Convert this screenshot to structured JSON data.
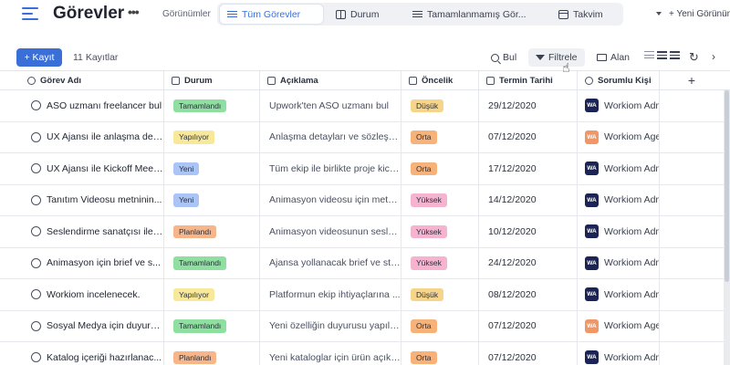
{
  "header": {
    "title": "Görevler",
    "more": "•••",
    "views_label": "Görünümler",
    "tabs": [
      {
        "label": "Tüm Görevler",
        "icon": "list-icon"
      },
      {
        "label": "Durum",
        "icon": "board-icon"
      },
      {
        "label": "Tamamlanmamış Gör...",
        "icon": "list-icon"
      },
      {
        "label": "Takvim",
        "icon": "calendar-icon"
      }
    ],
    "new_view": "+ Yeni Görünüm"
  },
  "toolbar": {
    "add_label": "+ Kayıt",
    "record_count": "11 Kayıtlar",
    "search_label": "Bul",
    "filter_label": "Filtrele",
    "field_label": "Alan",
    "refresh_glyph": "↻",
    "chevron_glyph": "›"
  },
  "table": {
    "columns": [
      "Görev Adı",
      "Durum",
      "Açıklama",
      "Öncelik",
      "Termin Tarihi",
      "Sorumlu Kişi"
    ],
    "add_column": "+",
    "rows": [
      {
        "title": "ASO uzmanı freelancer bul",
        "status": "Tamamlandı",
        "status_color": "#8fe0a0",
        "desc": "Upwork'ten ASO uzmanı bul",
        "priority": "Düşük",
        "priority_color": "#f6d48a",
        "date": "29/12/2020",
        "owner_initials": "WA",
        "owner_color": "#1c2456",
        "owner": "Workiom Adm"
      },
      {
        "title": "UX Ajansı ile anlaşma det...",
        "status": "Yapılıyor",
        "status_color": "#f7e89a",
        "desc": "Anlaşma detayları ve sözleşm...",
        "priority": "Orta",
        "priority_color": "#f7b27a",
        "date": "07/12/2020",
        "owner_initials": "WA",
        "owner_color": "#f19665",
        "owner": "Workiom Agen"
      },
      {
        "title": "UX Ajansı ile Kickoff Meet...",
        "status": "Yeni",
        "status_color": "#a9c4f5",
        "desc": "Tüm ekip ile birlikte proje kick...",
        "priority": "Orta",
        "priority_color": "#f7b27a",
        "date": "17/12/2020",
        "owner_initials": "WA",
        "owner_color": "#1c2456",
        "owner": "Workiom Adm"
      },
      {
        "title": "Tanıtım Videosu metninin...",
        "status": "Yeni",
        "status_color": "#a9c4f5",
        "desc": "Animasyon videosu için metn...",
        "priority": "Yüksek",
        "priority_color": "#f5b3cf",
        "date": "14/12/2020",
        "owner_initials": "WA",
        "owner_color": "#1c2456",
        "owner": "Workiom Adm"
      },
      {
        "title": "Seslendirme sanatçısı ile ...",
        "status": "Planlandı",
        "status_color": "#f7b58a",
        "desc": "Animasyon videosunun sesle...",
        "priority": "Yüksek",
        "priority_color": "#f5b3cf",
        "date": "10/12/2020",
        "owner_initials": "WA",
        "owner_color": "#1c2456",
        "owner": "Workiom Adm"
      },
      {
        "title": "Animasyon için brief ve s...",
        "status": "Tamamlandı",
        "status_color": "#8fe0a0",
        "desc": "Ajansa yollanacak brief ve sto...",
        "priority": "Yüksek",
        "priority_color": "#f5b3cf",
        "date": "24/12/2020",
        "owner_initials": "WA",
        "owner_color": "#1c2456",
        "owner": "Workiom Adm"
      },
      {
        "title": "Workiom incelenecek.",
        "status": "Yapılıyor",
        "status_color": "#f7e89a",
        "desc": "Platformun ekip ihtiyaçlarına ...",
        "priority": "Düşük",
        "priority_color": "#f6d48a",
        "date": "08/12/2020",
        "owner_initials": "WA",
        "owner_color": "#1c2456",
        "owner": "Workiom Adm"
      },
      {
        "title": "Sosyal Medya için duyuru...",
        "status": "Tamamlandı",
        "status_color": "#8fe0a0",
        "desc": "Yeni özelliğin duyurusu yapıla...",
        "priority": "Orta",
        "priority_color": "#f7b27a",
        "date": "07/12/2020",
        "owner_initials": "WA",
        "owner_color": "#f19665",
        "owner": "Workiom Agen"
      },
      {
        "title": "Katalog içeriği hazırlanac...",
        "status": "Planlandı",
        "status_color": "#f7b58a",
        "desc": "Yeni kataloglar için ürün açıkl...",
        "priority": "Orta",
        "priority_color": "#f7b27a",
        "date": "07/12/2020",
        "owner_initials": "WA",
        "owner_color": "#1c2456",
        "owner": "Workiom Adm"
      }
    ]
  },
  "colors": {
    "accent": "#3b6fd8"
  }
}
